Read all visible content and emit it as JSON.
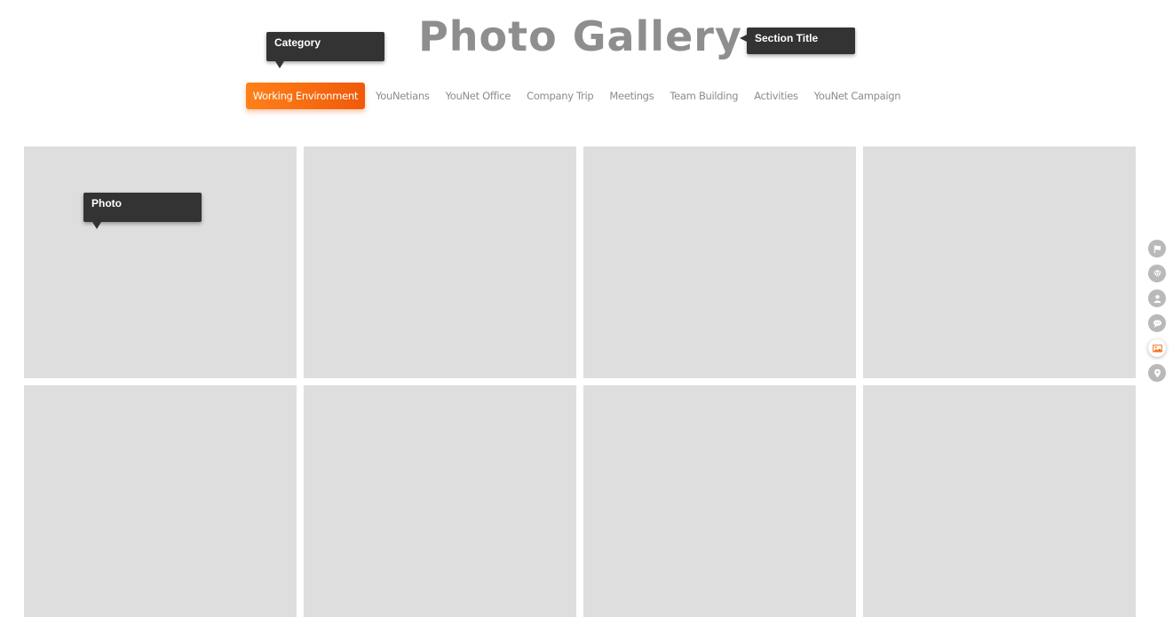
{
  "gallery": {
    "title": "Photo Gallery"
  },
  "tabs": [
    {
      "label": "Working Environment",
      "active": true
    },
    {
      "label": "YouNetians",
      "active": false
    },
    {
      "label": "YouNet Office",
      "active": false
    },
    {
      "label": "Company Trip",
      "active": false
    },
    {
      "label": "Meetings",
      "active": false
    },
    {
      "label": "Team Building",
      "active": false
    },
    {
      "label": "Activities",
      "active": false
    },
    {
      "label": "YouNet Campaign",
      "active": false
    }
  ],
  "photos_count": 8,
  "tooltips": {
    "category": "Category",
    "section_title": "Section Title",
    "photo": "Photo"
  },
  "side_nav": [
    {
      "icon": "flag-icon",
      "active": false
    },
    {
      "icon": "diamond-icon",
      "active": false
    },
    {
      "icon": "user-icon",
      "active": false
    },
    {
      "icon": "chat-icon",
      "active": false
    },
    {
      "icon": "image-icon",
      "active": true
    },
    {
      "icon": "map-pin-icon",
      "active": false
    }
  ],
  "colors": {
    "accent": "#f36f12",
    "title": "#8e8e8e",
    "tab_text": "#8c8c8c",
    "photo_placeholder": "#dedede",
    "tooltip_bg": "#333333",
    "side_nav_bg": "#b9b9b9"
  }
}
